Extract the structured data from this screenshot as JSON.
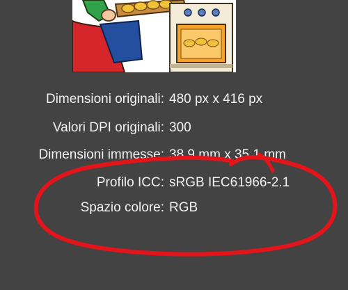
{
  "image_info": {
    "rows": [
      {
        "label": "Dimensioni originali:",
        "value": "480 px x 416 px"
      },
      {
        "label": "Valori DPI originali:",
        "value": "300"
      },
      {
        "label": "Dimensioni immesse:",
        "value": "38.9 mm x 35.1 mm"
      },
      {
        "label": "Profilo ICC:",
        "value": "sRGB IEC61966-2.1"
      },
      {
        "label": "Spazio colore:",
        "value": "RGB"
      }
    ]
  },
  "colors": {
    "background": "#434343",
    "text": "#f2f2f2",
    "annotation": "#e4141b"
  },
  "thumbnail_icon": "cartoon-baker-oven-image"
}
